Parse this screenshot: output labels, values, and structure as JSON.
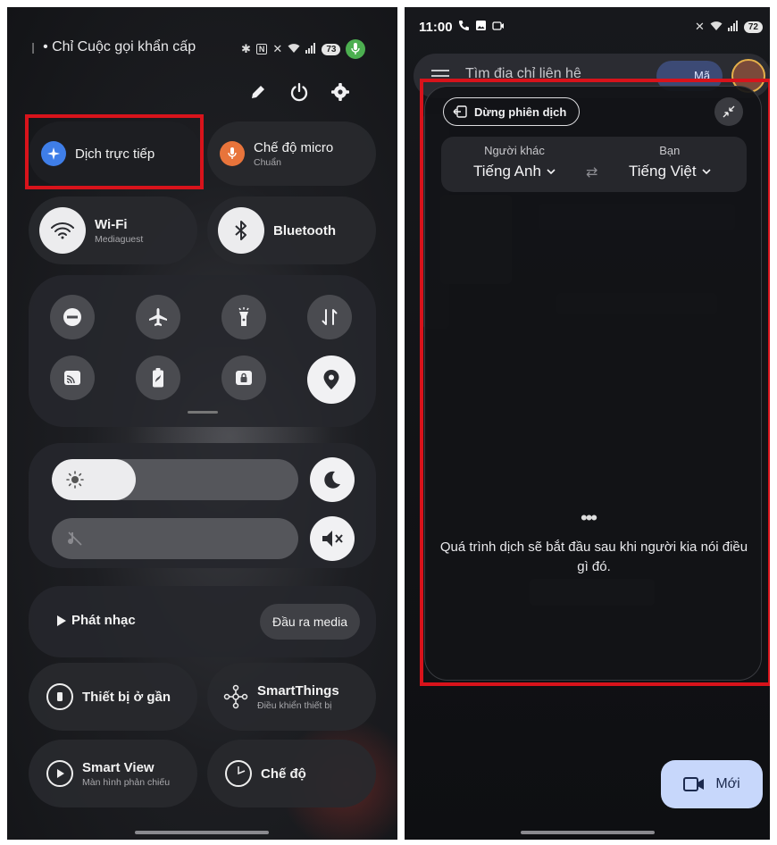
{
  "left": {
    "status_prefix": "❘",
    "carrier_text": "• Chỉ Cuộc gọi khẩn cấp",
    "battery": "73",
    "tiles": {
      "live_translate": "Dịch trực tiếp",
      "mic_mode_title": "Chế độ micro",
      "mic_mode_sub": "Chuẩn",
      "wifi_title": "Wi-Fi",
      "wifi_sub": "Mediaguest",
      "bluetooth_title": "Bluetooth"
    },
    "media": {
      "play_label": "Phát nhạc",
      "output_label": "Đầu ra media"
    },
    "bottom_tiles": {
      "nearby": "Thiết bị ở gần",
      "smartthings_title": "SmartThings",
      "smartthings_sub": "Điều khiển thiết bị",
      "smartview_title": "Smart View",
      "smartview_sub": "Màn hình phản chiếu",
      "mode": "Chế độ"
    },
    "brightness_level": 0.34,
    "volume_level": 0.0
  },
  "right": {
    "time": "11:00",
    "battery": "72",
    "search_placeholder": "Tìm địa chỉ liên hệ",
    "search_chip": "Mã",
    "stop_session": "Dừng phiên dịch",
    "other_label": "Người khác",
    "other_lang": "Tiếng Anh",
    "you_label": "Bạn",
    "you_lang": "Tiếng Việt",
    "waiting_text": "Quá trình dịch sẽ bắt đầu sau khi người kia nói điều gì đó.",
    "new_button": "Mới"
  },
  "colors": {
    "highlight": "#d8131b",
    "translate_icon": "#3f7ee8",
    "mic_icon": "#e8743b",
    "new_button_bg": "#c7d7fb"
  }
}
